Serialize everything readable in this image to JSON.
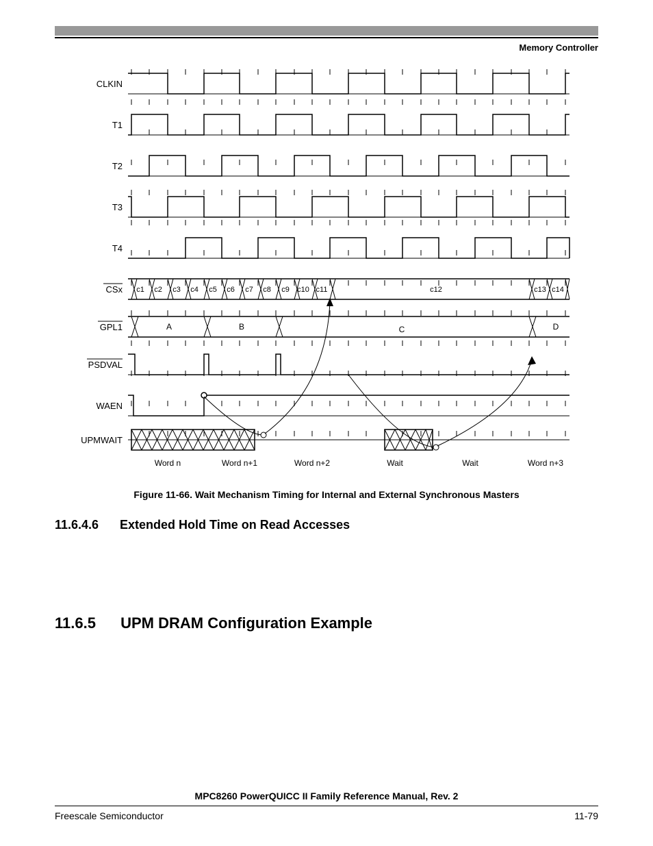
{
  "header": {
    "section": "Memory Controller"
  },
  "figure": {
    "signals": [
      "CLKIN",
      "T1",
      "T2",
      "T3",
      "T4",
      "CSx",
      "GPL1",
      "PSDVAL",
      "WAEN",
      "UPMWAIT"
    ],
    "overline_signals": [
      "CSx",
      "GPL1",
      "PSDVAL"
    ],
    "csx_cycles": [
      "c1",
      "c2",
      "c3",
      "c4",
      "c5",
      "c6",
      "c7",
      "c8",
      "c9",
      "c10",
      "c11",
      "c12",
      "c13",
      "c14"
    ],
    "gpl_segments": [
      "A",
      "B",
      "C",
      "D"
    ],
    "words": [
      "Word n",
      "Word n+1",
      "Word n+2",
      "Wait",
      "Wait",
      "Word n+3"
    ],
    "caption": "Figure 11-66. Wait Mechanism Timing for Internal and External Synchronous Masters"
  },
  "sections": {
    "s1_num": "11.6.4.6",
    "s1_title": "Extended Hold Time on Read Accesses",
    "s2_num": "11.6.5",
    "s2_title": "UPM DRAM Configuration Example"
  },
  "footer": {
    "title": "MPC8260 PowerQUICC II Family Reference Manual, Rev. 2",
    "left": "Freescale Semiconductor",
    "right": "11-79"
  }
}
